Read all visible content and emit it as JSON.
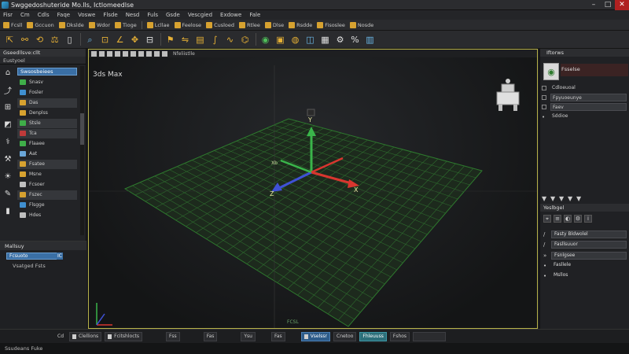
{
  "window": {
    "title": "Swggedoshuteride Mo.lls, Ictlomeedlse",
    "controls": [
      "minimize-icon",
      "maximize-icon",
      "close-icon"
    ]
  },
  "menu": [
    "Fisr",
    "Cm",
    "Cdls",
    "Faqe",
    "Voswe",
    "Flsde",
    "Nesd",
    "Fuls",
    "Gsde",
    "Vescgied",
    "Exdowe",
    "Fale"
  ],
  "toolbar1": {
    "items": [
      "Fcsll",
      "Gccuon",
      "Dkslde",
      "Wdor",
      "Tioge",
      "Lcllae",
      "Feelose",
      "Cusloed",
      "Rtlee",
      "Dlse",
      "Rsdde",
      "Fisoslee",
      "Nosde"
    ]
  },
  "toolbar2": {
    "icons": [
      "select-icon",
      "link-icon",
      "rotate-icon",
      "scale-icon",
      "file-icon",
      "zoom-icon",
      "snap-icon",
      "angle-icon",
      "move-icon",
      "align-icon",
      "flag-icon",
      "mirror-icon",
      "layer-icon",
      "curve-icon",
      "wave-icon",
      "graph-icon",
      "render-icon",
      "render-frame-icon",
      "material-icon",
      "slate-icon",
      "grid-icon",
      "settings-icon",
      "percent-icon",
      "help-icon"
    ]
  },
  "left_panel": {
    "header": "Gseedllsve:cllt",
    "subheader": "Eustyoel",
    "dropdown": "Swsosbeiees",
    "items": [
      "Snasv",
      "Fosler",
      "Das",
      "Denplss",
      "Stsle",
      "Tca",
      "Flaaee",
      "Aat",
      "Fsatee",
      "Msne",
      "Fcsoer",
      "Fszec",
      "Flsgge",
      "Hdes"
    ],
    "lower_header": "Mallsuy",
    "lower_field": "Fcsuoto",
    "lower_field_btn": "IC",
    "lower_text": "Vsatged Fsts"
  },
  "viewport": {
    "tabs_label": "Nfeliistlle",
    "label": "3ds Max",
    "axis_x": "X",
    "axis_y": "Y",
    "axis_z": "Z",
    "bottom_label": "FCSL",
    "corner_label": "Xb"
  },
  "right_panel": {
    "header": "Iftorws",
    "object_name": "Fsselse",
    "rows": [
      "Cdloeuoal",
      "Fpyuoeunye",
      "Faev",
      "Sddioe"
    ],
    "tabs": [
      "▼",
      "▼",
      "▼",
      "▼",
      "▼"
    ],
    "modifier_header": "Yeslbgel",
    "modifier_icons": [
      "pin-icon",
      "stack-icon",
      "material-icon",
      "config-icon",
      "info-icon"
    ],
    "fields": [
      {
        "key": "/",
        "value": "Fasty Bldwolel"
      },
      {
        "key": "/",
        "value": "Fasllsuuor"
      },
      {
        "key": "",
        "value": "Fsnlgsee"
      },
      {
        "key": "",
        "value": "Fasllele"
      },
      {
        "key": "",
        "value": "Msllos"
      }
    ]
  },
  "status": {
    "cells": [
      "Cd",
      "Clellions",
      "Fcitshlocts",
      "Fss",
      "Fas",
      "Ysu",
      "Fas",
      "Vselssr",
      "Cnetoo",
      "Fhleuuss",
      "Fshos"
    ],
    "bottom": "Ssudeans Fuke"
  },
  "colors": {
    "accent": "#d7a230",
    "selection": "#3a6fa5",
    "viewport_border": "#b7b24a",
    "grid": "#2e6b2e",
    "axis_x": "#d8362f",
    "axis_y": "#3ab54a",
    "axis_z": "#3f51d6"
  }
}
